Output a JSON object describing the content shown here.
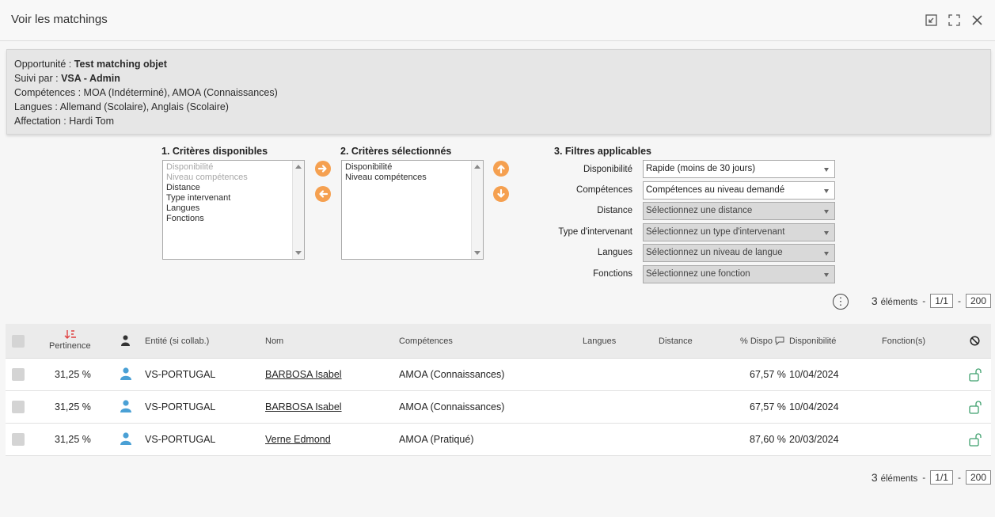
{
  "window": {
    "title": "Voir les matchings"
  },
  "info": {
    "opportunite_label": "Opportunité : ",
    "opportunite_value": "Test matching objet",
    "suivi_label": "Suivi par : ",
    "suivi_value": "VSA - Admin",
    "competences_line": "Compétences : MOA (Indéterminé), AMOA (Connaissances)",
    "langues_line": "Langues : Allemand (Scolaire), Anglais (Scolaire)",
    "affectation_line": "Affectation : Hardi Tom"
  },
  "criteres_disponibles": {
    "title": "1. Critères disponibles",
    "options": [
      {
        "label": "Disponibilité",
        "disabled": true
      },
      {
        "label": "Niveau compétences",
        "disabled": true
      },
      {
        "label": "Distance",
        "disabled": false
      },
      {
        "label": "Type intervenant",
        "disabled": false
      },
      {
        "label": "Langues",
        "disabled": false
      },
      {
        "label": "Fonctions",
        "disabled": false
      }
    ]
  },
  "criteres_selectionnes": {
    "title": "2. Critères sélectionnés",
    "options": [
      "Disponibilité",
      "Niveau compétences"
    ]
  },
  "filtres": {
    "title": "3. Filtres applicables",
    "items": [
      {
        "label": "Disponibilité",
        "value": "Rapide (moins de 30 jours)",
        "enabled": true
      },
      {
        "label": "Compétences",
        "value": "Compétences au niveau demandé",
        "enabled": true
      },
      {
        "label": "Distance",
        "value": "Sélectionnez une distance",
        "enabled": false
      },
      {
        "label": "Type d'intervenant",
        "value": "Sélectionnez un type d'intervenant",
        "enabled": false
      },
      {
        "label": "Langues",
        "value": "Sélectionnez un niveau de langue",
        "enabled": false
      },
      {
        "label": "Fonctions",
        "value": "Sélectionnez une fonction",
        "enabled": false
      }
    ]
  },
  "pager": {
    "count": "3",
    "count_label": "éléments",
    "sep": "-",
    "page": "1/1",
    "page_size": "200"
  },
  "table": {
    "headers": {
      "pertinence": "Pertinence",
      "entite": "Entité (si collab.)",
      "nom": "Nom",
      "competences": "Compétences",
      "langues": "Langues",
      "distance": "Distance",
      "dispo_pct": "% Dispo",
      "disponibilite": "Disponibilité",
      "fonctions": "Fonction(s)"
    },
    "rows": [
      {
        "pertinence": "31,25 %",
        "entite": "VS-PORTUGAL",
        "nom": "BARBOSA Isabel",
        "competences": "AMOA (Connaissances)",
        "dispo_pct": "67,57 %",
        "disponibilite": "10/04/2024"
      },
      {
        "pertinence": "31,25 %",
        "entite": "VS-PORTUGAL",
        "nom": "BARBOSA Isabel",
        "competences": "AMOA (Connaissances)",
        "dispo_pct": "67,57 %",
        "disponibilite": "10/04/2024"
      },
      {
        "pertinence": "31,25 %",
        "entite": "VS-PORTUGAL",
        "nom": "Verne Edmond",
        "competences": "AMOA (Pratiqué)",
        "dispo_pct": "87,60 %",
        "disponibilite": "20/03/2024"
      }
    ]
  },
  "colors": {
    "accent_orange": "#f5a050",
    "user_icon_blue": "#4aa0d5",
    "lock_green": "#3fa06e",
    "sort_red": "#e04040"
  }
}
